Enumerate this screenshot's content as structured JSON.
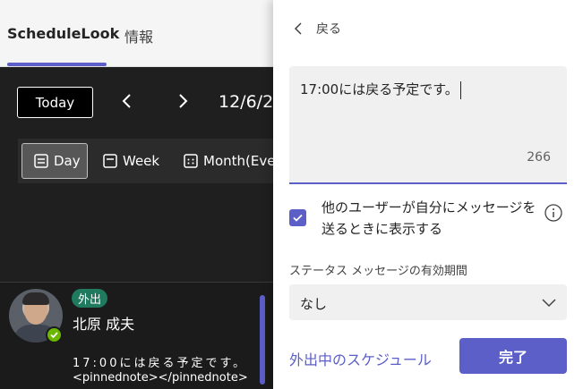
{
  "tabs": [
    {
      "label": "ScheduleLook",
      "active": true
    },
    {
      "label": "情報",
      "active": false
    }
  ],
  "toolbar": {
    "today_label": "Today",
    "date_text": "12/6/2"
  },
  "views": [
    {
      "label": "Day",
      "icon": "day-view-icon",
      "selected": true
    },
    {
      "label": "Week",
      "icon": "week-view-icon",
      "selected": false
    },
    {
      "label": "Month(Eve",
      "icon": "month-view-icon",
      "selected": false
    }
  ],
  "person": {
    "badge": "外出",
    "name": "北原 成夫",
    "message": "17:00には戻る予定です。",
    "note": "<pinnednote></pinnednote>"
  },
  "panel": {
    "back_label": "戻る",
    "message_value": "17:00には戻る予定です。",
    "char_count": "266",
    "checkbox_label": "他のユーザーが自分にメッセージを送るときに表示する",
    "checkbox_checked": true,
    "duration_label": "ステータス メッセージの有効期間",
    "duration_value": "なし",
    "schedule_link": "外出中のスケジュール",
    "done_label": "完了"
  },
  "colors": {
    "accent": "#5b5fc7",
    "badge_green": "#1f7a5e",
    "presence_green": "#6bb700",
    "dark_bg": "#1f1f1f"
  }
}
